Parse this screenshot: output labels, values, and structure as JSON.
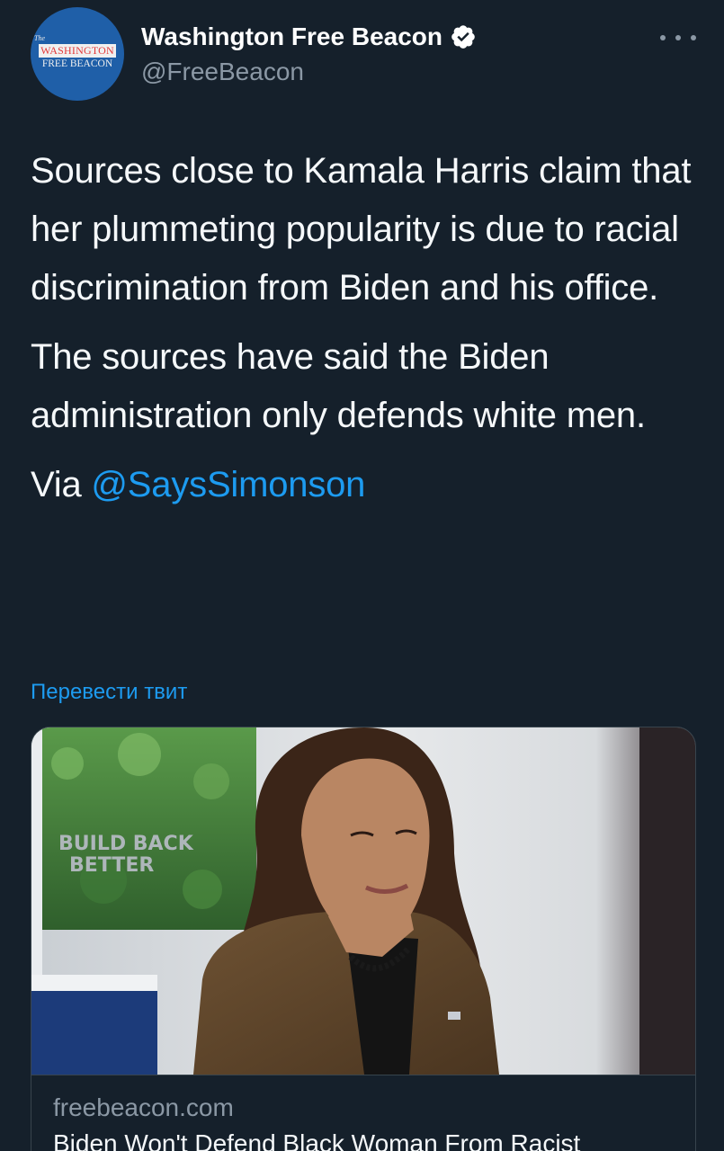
{
  "header": {
    "display_name": "Washington Free Beacon",
    "handle": "@FreeBeacon",
    "avatar_logo": {
      "the": "The",
      "line1": "WASHINGTON",
      "line2": "FREE BEACON"
    },
    "verified_icon": "verified-badge-icon",
    "more_icon": "more-options-icon"
  },
  "tweet": {
    "paragraph1": "Sources close to Kamala Harris claim that her plummeting popularity is due to racial discrimination from Biden and his office.",
    "paragraph2": "The sources have said the Biden administration only defends white men.",
    "via_prefix": "Via ",
    "mention": "@SaysSimonson"
  },
  "translate_label": "Перевести твит",
  "card": {
    "image_sign_text": "BUILD BACK BETTER",
    "domain": "freebeacon.com",
    "title": "Biden Won't Defend Black Woman From Racist"
  },
  "colors": {
    "background": "#15202b",
    "accent": "#1d9bf0",
    "secondary_text": "#8b98a5",
    "border": "#38444d"
  }
}
